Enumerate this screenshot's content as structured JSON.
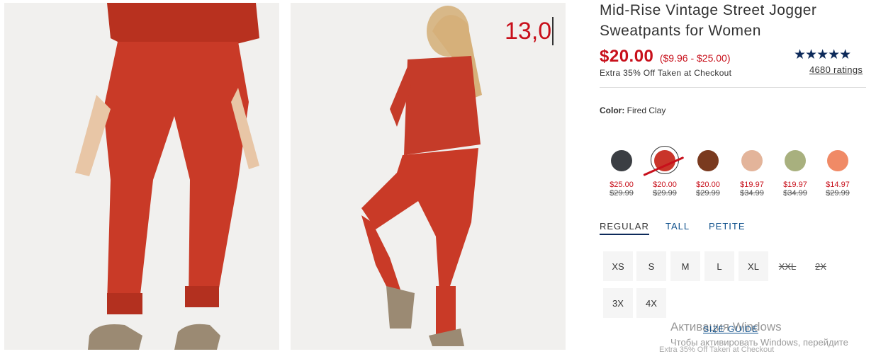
{
  "overlay": {
    "typed_value": "13,0"
  },
  "product": {
    "title": "Mid-Rise Vintage Street Jogger Sweatpants for Women",
    "price": "$20.00",
    "price_range": "($9.96 - $25.00)",
    "promo": "Extra 35% Off Taken at Checkout",
    "stars": "★★★★★",
    "ratings": "4680 ratings",
    "color_label": "Color:",
    "color_value": "Fired Clay"
  },
  "swatches": [
    {
      "color": "#3b3e43",
      "sale": "$25.00",
      "orig": "$29.99"
    },
    {
      "color": "#c9352a",
      "sale": "$20.00",
      "orig": "$29.99"
    },
    {
      "color": "#7a3a1f",
      "sale": "$20.00",
      "orig": "$29.99"
    },
    {
      "color": "#e3b49a",
      "sale": "$19.97",
      "orig": "$34.99"
    },
    {
      "color": "#a8b07e",
      "sale": "$19.97",
      "orig": "$34.99"
    },
    {
      "color": "#f08a66",
      "sale": "$14.97",
      "orig": "$29.99"
    }
  ],
  "tabs": [
    "REGULAR",
    "TALL",
    "PETITE"
  ],
  "sizes": [
    "XS",
    "S",
    "M",
    "L",
    "XL",
    "XXL",
    "2X",
    "3X",
    "4X"
  ],
  "size_guide": "SIZE GUIDE",
  "watermark": {
    "title": "Активация Windows",
    "sub": "Чтобы активировать Windows, перейдите"
  },
  "cut_text": "Extra 35% Off Taken at Checkout",
  "colors": {
    "sale_red": "#c8101b",
    "link_blue": "#0d4f8b",
    "star_navy": "#0d2a5a"
  }
}
